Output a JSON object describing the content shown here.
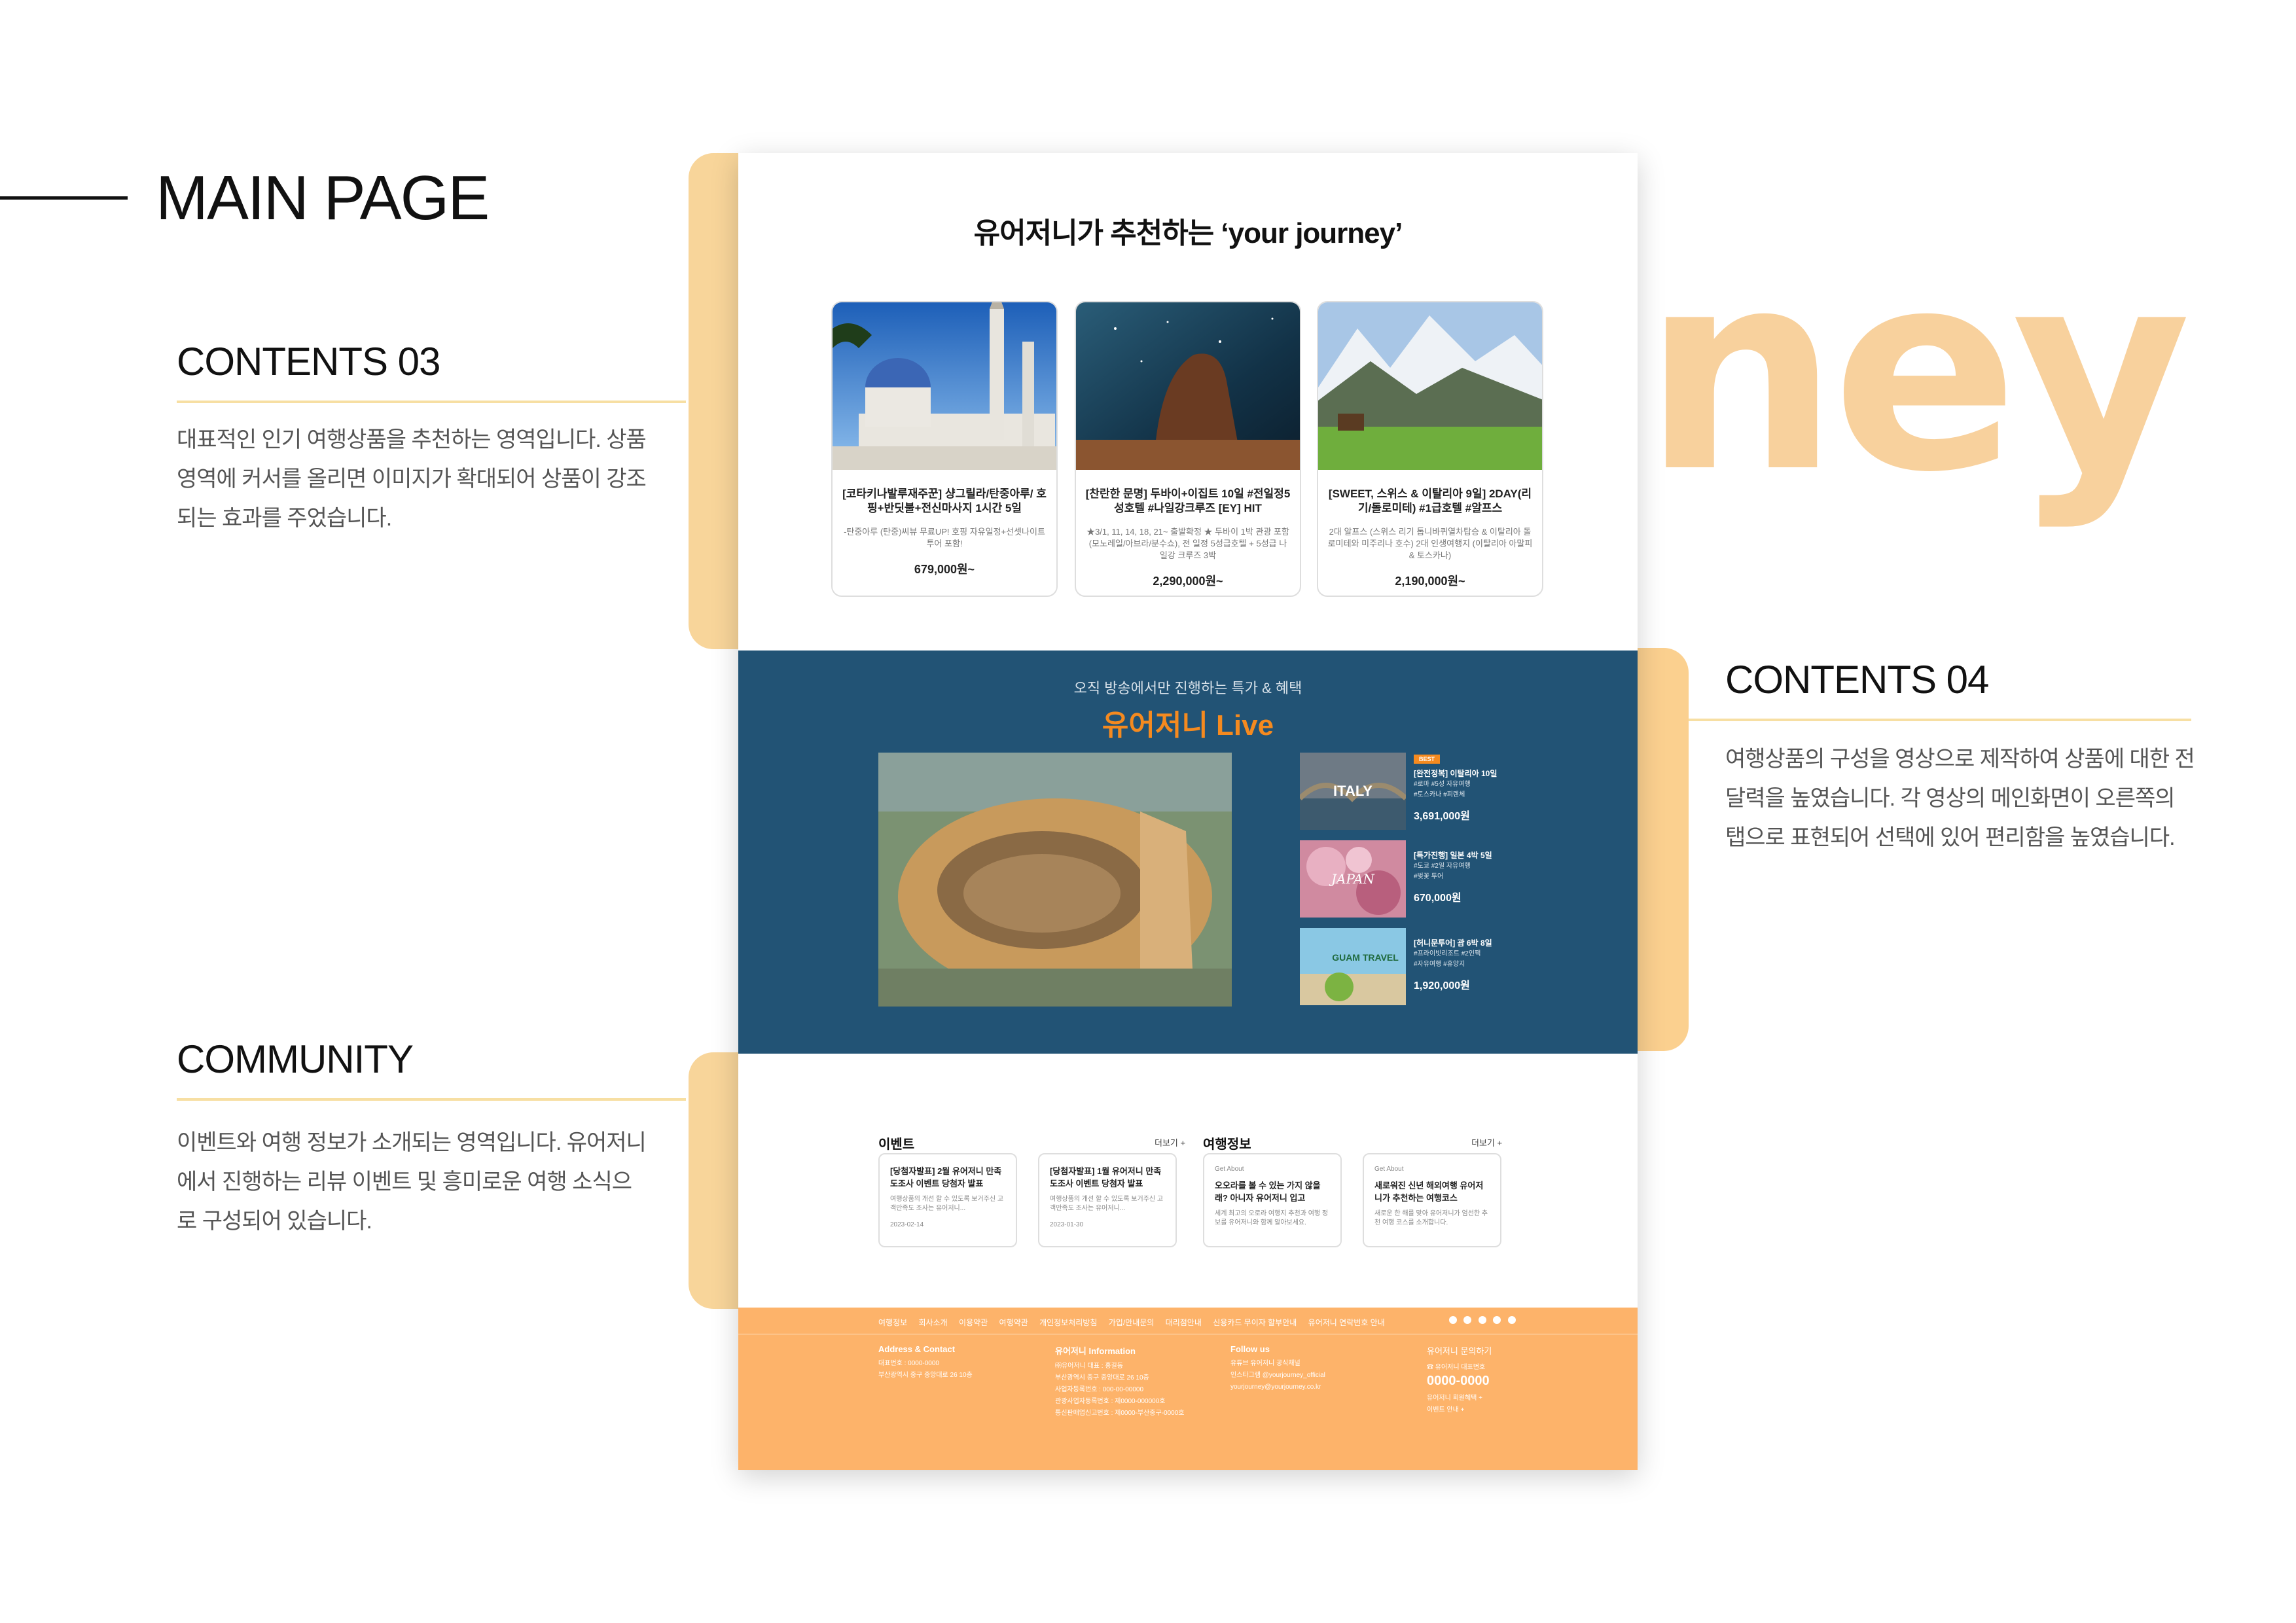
{
  "heading": "MAIN PAGE",
  "decor_text": "ney",
  "sections": {
    "contents03": {
      "title": "CONTENTS 03",
      "desc": [
        "대표적인 인기 여행상품을 추천하는 영역입니다. 상품",
        "영역에 커서를 올리면 이미지가 확대되어 상품이 강조",
        "되는 효과를 주었습니다."
      ]
    },
    "contents04": {
      "title": "CONTENTS 04",
      "desc": [
        "여행상품의 구성을 영상으로 제작하여 상품에 대한 전",
        "달력을 높였습니다. 각 영상의 메인화면이 오른쪽의",
        "탭으로 표현되어 선택에 있어 편리함을 높였습니다."
      ]
    },
    "community": {
      "title": "COMMUNITY",
      "desc": [
        "이벤트와 여행 정보가 소개되는 영역입니다. 유어저니",
        "에서 진행하는 리뷰 이벤트 및 흥미로운 여행 소식으",
        "로 구성되어 있습니다."
      ]
    }
  },
  "page": {
    "recommend_title": "유어저니가 추천하는 ‘your journey’",
    "cards": [
      {
        "title": "[코타키나발루재주꾼] 샹그릴라/탄중아루/ 호핑+반딧불+전신마사지 1시간 5일",
        "desc": "-탄중아루 (탄중)씨뷰 무료UP! 호핑 자유일정+선셋나이트투어 포함!",
        "price": "679,000원~"
      },
      {
        "title": "[찬란한 문명] 두바이+이집트 10일 #전일정5성호텔 #나일강크루즈 [EY] HIT",
        "desc": "★3/1, 11, 14, 18, 21~ 출발확정 ★ 두바이 1박 관광 포함 (모노레일/아브라/분수쇼), 전 일정 5성급호텔 + 5성급 나일강 크루즈 3박",
        "price": "2,290,000원~"
      },
      {
        "title": "[SWEET, 스위스 & 이탈리아 9일] 2DAY(리기/돌로미테) #1급호텔 #알프스",
        "desc": "2대 알프스 (스위스 리기 톱니바퀴열차탑승 & 이탈리아 돌로미테와 미주리나 호수) 2대 인생여행지 (이탈리아 아말피 & 토스카나)",
        "price": "2,190,000원~"
      }
    ],
    "live": {
      "subtitle": "오직 방송에서만 진행하는 특가 & 혜택",
      "title": "유어저니 Live",
      "items": [
        {
          "badge": "BEST",
          "title": "[완전정복] 이탈리아 10일",
          "tags": [
            "#로마 #5성 자유여행",
            "#토스카나 #피렌체"
          ],
          "price": "3,691,000원",
          "thumb": "ITALY"
        },
        {
          "badge": "",
          "title": "[특가진행] 일본 4박 5일",
          "tags": [
            "#도쿄 #2일 자유여행",
            "#벚꽃 투어"
          ],
          "price": "670,000원",
          "thumb": "JAPAN"
        },
        {
          "badge": "",
          "title": "[허니문투어] 괌 6박 8일",
          "tags": [
            "#프라이빗리조트 #2인팩",
            "#자유여행 #휴양지"
          ],
          "price": "1,920,000원",
          "thumb": "GUAM TRAVEL"
        }
      ]
    },
    "community": {
      "event_title": "이벤트",
      "info_title": "여행정보",
      "more": "더보기 +",
      "events": [
        {
          "title": "[당첨자발표] 2월 유어저니 만족도조사 이벤트 당첨자 발표",
          "desc": "여행상품의 개선 할 수 있도록 보거주신 고객만족도 조사는 유어저니...",
          "date": "2023-02-14"
        },
        {
          "title": "[당첨자발표] 1월 유어저니 만족도조사 이벤트 당첨자 발표",
          "desc": "여행상품의 개선 할 수 있도록 보거주신 고객만족도 조사는 유어저니...",
          "date": "2023-01-30"
        }
      ],
      "infos": [
        {
          "label": "Get About",
          "title": "오오라를 볼 수 있는 가지 않을래? 아니자 유어저니 입고",
          "desc": "세계 최고의 오로라 여행지 추천과 여행 정보를 유어저니와 함께 알아보세요."
        },
        {
          "label": "Get About",
          "title": "새로워진 신년 해외여행 유어저니가 추천하는 여행코스",
          "desc": "새로운 한 해를 맞아 유어저니가 엄선한 추천 여행 코스를 소개합니다."
        }
      ]
    },
    "footer": {
      "nav": [
        "여행정보",
        "회사소개",
        "이용약관",
        "여행약관",
        "개인정보처리방침",
        "가입/안내문의",
        "대리점안내",
        "신용카드 무이자 할부안내",
        "유어저니 연락번호 안내"
      ],
      "cols": [
        {
          "head": "Address & Contact",
          "lines": [
            "대표번호 : 0000-0000",
            "부산광역시 중구 중앙대로 26 10층"
          ]
        },
        {
          "head": "유어저니 Information",
          "lines": [
            "㈜유어저니 대표 : 홍길동",
            "부산광역시 중구 중앙대로 26 10층",
            "사업자등록번호 : 000-00-00000",
            "관광사업자등록번호 : 제0000-000000호",
            "통신판매업신고번호 : 제0000-부산중구-0000호"
          ]
        },
        {
          "head": "Follow us",
          "lines": [
            "유튜브 유어저니 공식채널",
            "인스타그램 @yourjourney_official",
            "yourjourney@yourjourney.co.kr"
          ]
        }
      ],
      "inquiry": "유어저니 문의하기",
      "phone_label": "☎ 유어저니 대표번호",
      "phone": "0000-0000",
      "sub_links": [
        "유어저니 회원혜택 +",
        "이벤트 안내 +"
      ]
    }
  },
  "colors": {
    "accent": "#f8d59a",
    "live_bg": "#225375",
    "footer": "#fdb36a",
    "orange": "#f58a1f"
  }
}
